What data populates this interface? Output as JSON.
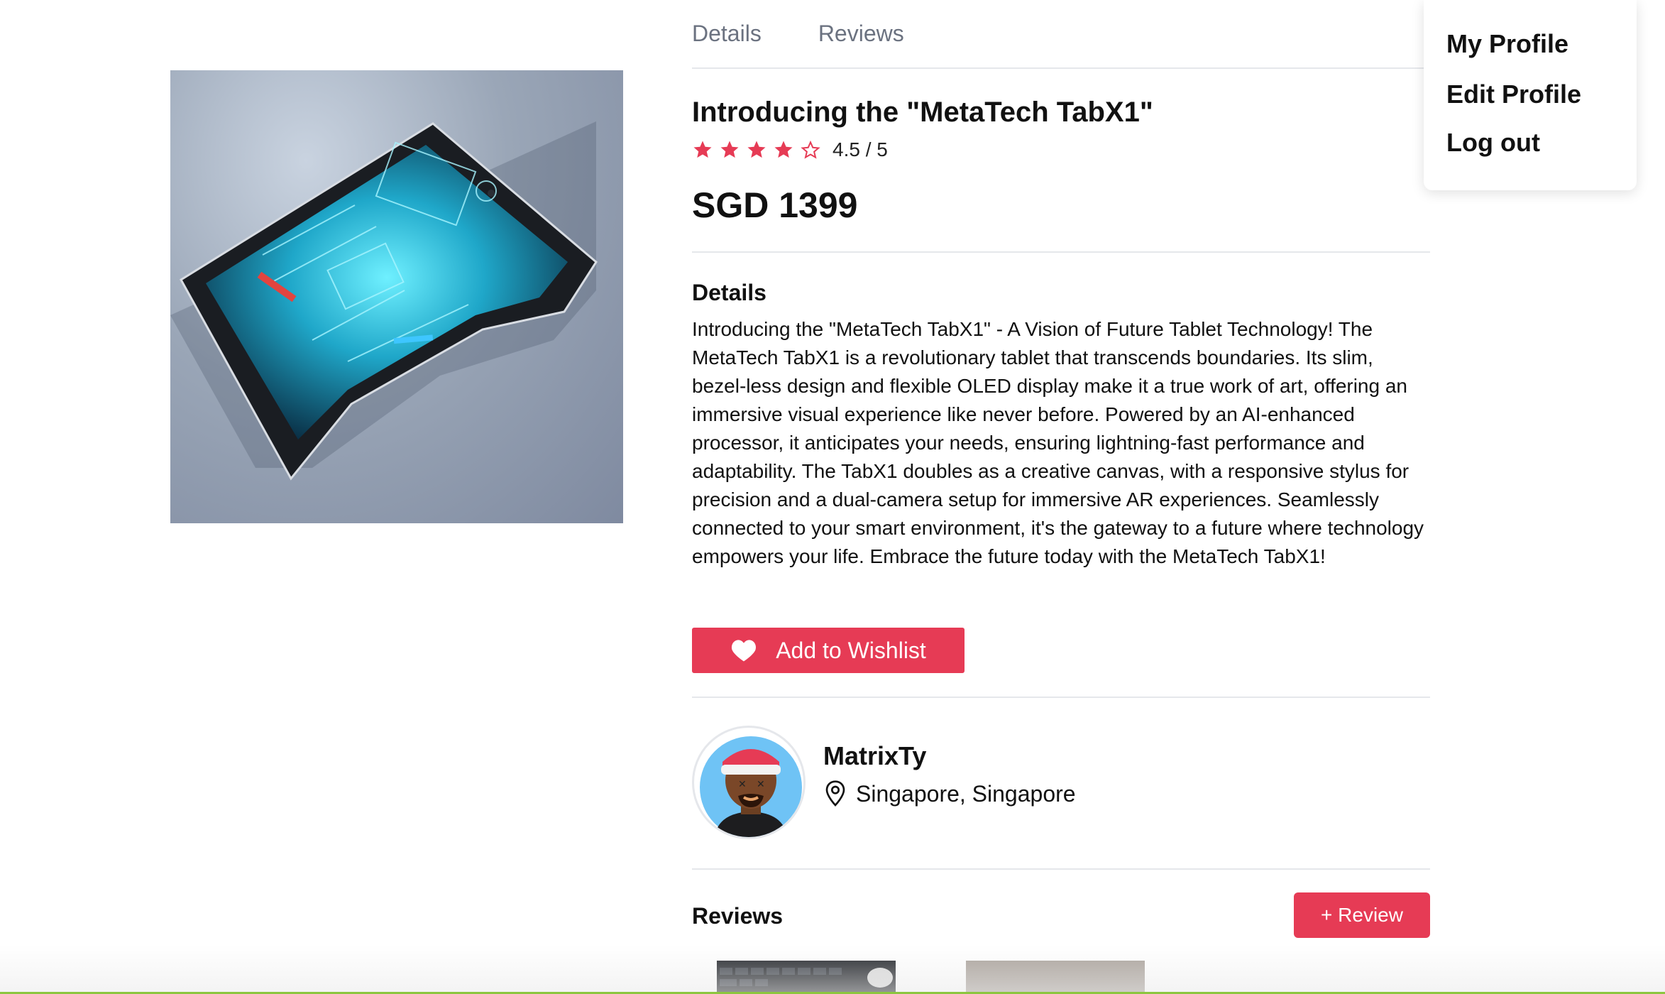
{
  "tabs": [
    {
      "label": "Details"
    },
    {
      "label": "Reviews"
    }
  ],
  "product": {
    "title": "Introducing the \"MetaTech TabX1\"",
    "rating": 4.5,
    "rating_text": "4.5 / 5",
    "price": "SGD 1399",
    "details_heading": "Details",
    "description": "Introducing the \"MetaTech TabX1\" - A Vision of Future Tablet Technology! The MetaTech TabX1 is a revolutionary tablet that transcends boundaries. Its slim, bezel-less design and flexible OLED display make it a true work of art, offering an immersive visual experience like never before. Powered by an AI-enhanced processor, it anticipates your needs, ensuring lightning-fast performance and adaptability. The TabX1 doubles as a creative canvas, with a responsive stylus for precision and a dual-camera setup for immersive AR experiences. Seamlessly connected to your smart environment, it's the gateway to a future where technology empowers your life. Embrace the future today with the MetaTech TabX1!",
    "wishlist_label": "Add to Wishlist"
  },
  "seller": {
    "name": "MatrixTy",
    "location": "Singapore, Singapore"
  },
  "reviews": {
    "heading": "Reviews",
    "add_label": "+ Review"
  },
  "profile_menu": {
    "items": [
      {
        "label": "My Profile"
      },
      {
        "label": "Edit Profile"
      },
      {
        "label": "Log out"
      }
    ]
  },
  "colors": {
    "accent": "#e63b55",
    "star": "#e63b55",
    "tab_text": "#6b7280",
    "divider": "#e5e7eb"
  }
}
